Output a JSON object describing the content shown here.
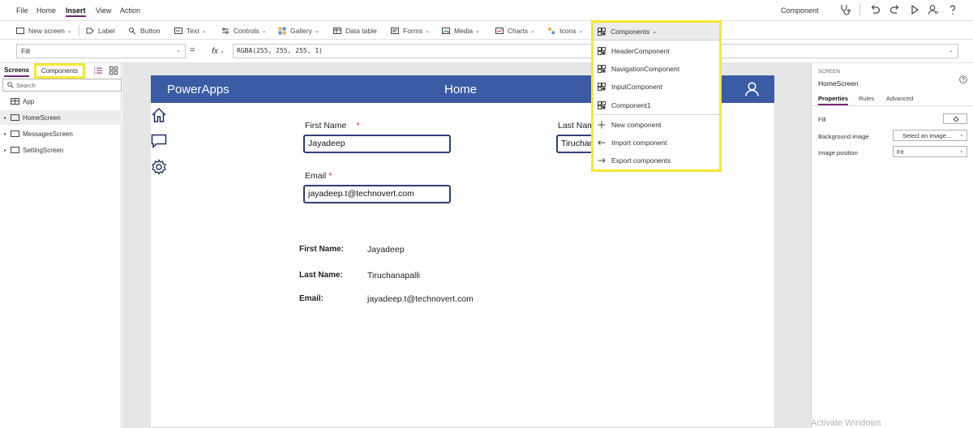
{
  "menu": {
    "items": [
      {
        "label": "File",
        "active": false
      },
      {
        "label": "Home",
        "active": false
      },
      {
        "label": "Insert",
        "active": true
      },
      {
        "label": "View",
        "active": false
      },
      {
        "label": "Action",
        "active": false
      }
    ],
    "right_label": "Component",
    "right_icons": [
      "stethoscope-icon",
      "undo-icon",
      "redo-icon",
      "play-icon",
      "user-icon",
      "help-icon"
    ]
  },
  "ribbon": {
    "items": [
      {
        "label": "New screen",
        "icon": "new-screen-icon",
        "chevron": true
      },
      {
        "label": "Label",
        "icon": "label-icon",
        "chevron": false
      },
      {
        "label": "Button",
        "icon": "button-icon",
        "chevron": false
      },
      {
        "label": "Text",
        "icon": "text-icon",
        "chevron": true
      },
      {
        "label": "Controls",
        "icon": "controls-icon",
        "chevron": true
      },
      {
        "label": "Gallery",
        "icon": "gallery-icon",
        "chevron": true
      },
      {
        "label": "Data table",
        "icon": "data-table-icon",
        "chevron": false
      },
      {
        "label": "Forms",
        "icon": "forms-icon",
        "chevron": true
      },
      {
        "label": "Media",
        "icon": "media-icon",
        "chevron": true
      },
      {
        "label": "Charts",
        "icon": "charts-icon",
        "chevron": true
      },
      {
        "label": "Icons",
        "icon": "icons-icon",
        "chevron": true
      }
    ],
    "components_button": {
      "label": "Components",
      "icon": "components-icon"
    }
  },
  "formula_bar": {
    "property": "Fill",
    "equals": "=",
    "fx": "fx",
    "formula": "RGBA(255, 255, 255, 1)"
  },
  "left_panel": {
    "tabs": {
      "screens": "Screens",
      "components": "Components"
    },
    "search_placeholder": "Search",
    "tree": [
      {
        "label": "App",
        "icon": "app-icon",
        "caret": false,
        "selected": false
      },
      {
        "label": "HomeScreen",
        "icon": "screen-icon",
        "caret": true,
        "selected": true
      },
      {
        "label": "MessagesScreen",
        "icon": "screen-icon",
        "caret": true,
        "selected": false
      },
      {
        "label": "SettingScreen",
        "icon": "screen-icon",
        "caret": true,
        "selected": false
      }
    ]
  },
  "app": {
    "header": {
      "title": "PowerApps",
      "screen_title": "Home"
    },
    "nav_icons": [
      "home-icon",
      "chat-icon",
      "settings-icon"
    ],
    "form": {
      "first_name": {
        "label": "First Name",
        "required_mark": "*",
        "value": "Jayadeep"
      },
      "last_name": {
        "label": "Last Nam",
        "value": "Tiruchan"
      },
      "email": {
        "label": "Email",
        "required_mark": "*",
        "value": "jayadeep.t@technovert.com"
      }
    },
    "summary": [
      {
        "label": "First Name:",
        "value": "Jayadeep"
      },
      {
        "label": "Last Name:",
        "value": "Tiruchanapalli"
      },
      {
        "label": "Email:",
        "value": "jayadeep.t@technovert.com"
      }
    ]
  },
  "components_menu": {
    "items": [
      {
        "label": "HeaderComponent",
        "icon": "component-icon"
      },
      {
        "label": "NavigationComponent",
        "icon": "component-icon"
      },
      {
        "label": "InputComponent",
        "icon": "component-icon"
      },
      {
        "label": "Component1",
        "icon": "component-icon"
      },
      {
        "label": "New component",
        "icon": "plus-icon"
      },
      {
        "label": "Import component",
        "icon": "import-icon"
      },
      {
        "label": "Export components",
        "icon": "export-icon"
      }
    ]
  },
  "right_panel": {
    "kind": "SCREEN",
    "name": "HomeScreen",
    "tabs": [
      "Properties",
      "Rules",
      "Advanced"
    ],
    "active_tab": "Properties",
    "fill_label": "Fill",
    "background_image_label": "Background image",
    "background_image_value": "Select an image...",
    "image_position_label": "Image position",
    "image_position_value": "Fit"
  },
  "watermark": "Activate Windows",
  "colors": {
    "header_blue": "#3b5ba5",
    "highlight_yellow": "#f5e832",
    "accent_purple": "#742774",
    "input_border": "#2e3f77",
    "required_red": "#c72c2c"
  }
}
